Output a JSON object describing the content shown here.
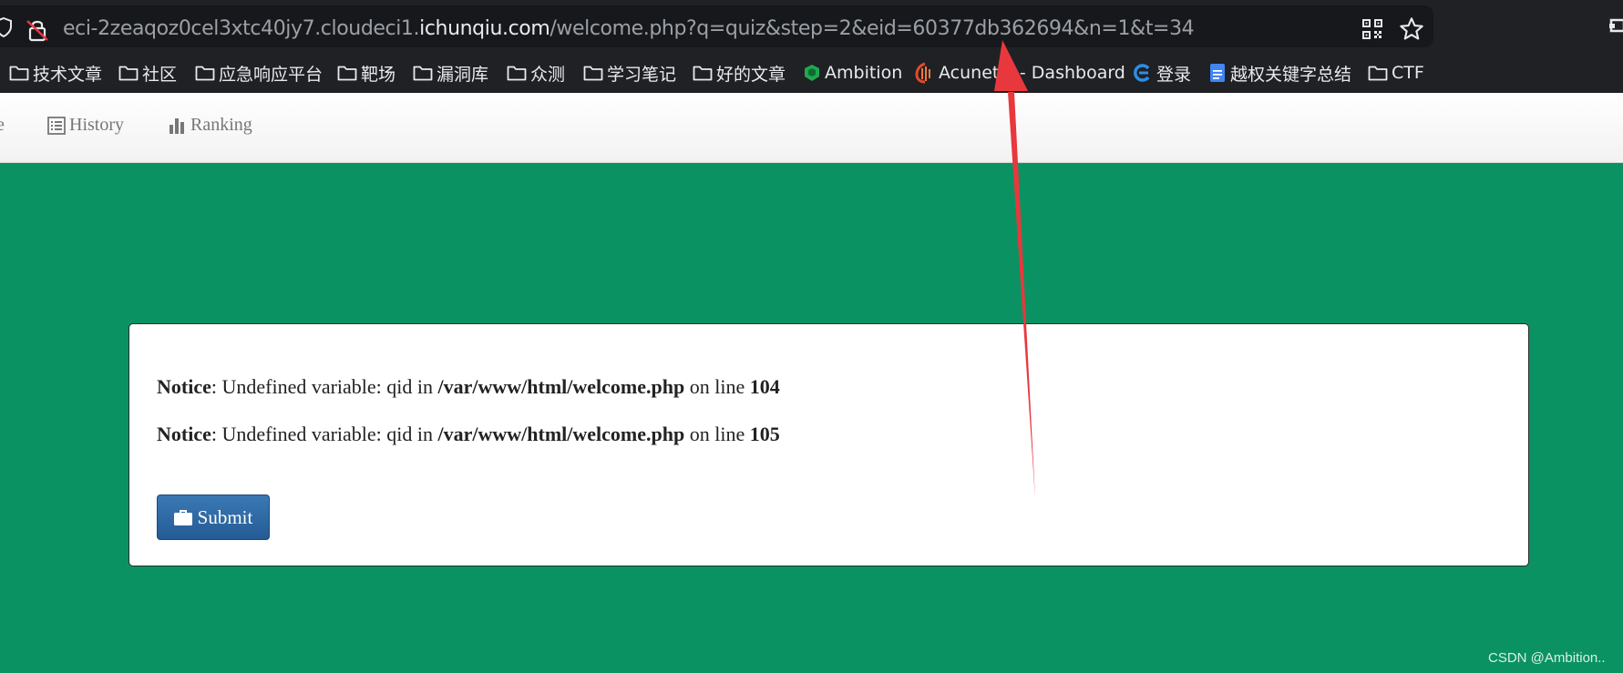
{
  "browser": {
    "url_prefix": "eci-2zeaqoz0cel3xtc40jy7.cloudeci1.",
    "url_domain": "ichunqiu.com",
    "url_path": "/welcome.php?q=quiz&step=2&eid=60377db362694&n=1&t=34"
  },
  "bookmarks": [
    {
      "label": "技术文章",
      "icon": "folder-icon"
    },
    {
      "label": "社区",
      "icon": "folder-icon"
    },
    {
      "label": "应急响应平台",
      "icon": "folder-icon"
    },
    {
      "label": "靶场",
      "icon": "folder-icon"
    },
    {
      "label": "漏洞库",
      "icon": "folder-icon"
    },
    {
      "label": "众测",
      "icon": "folder-icon"
    },
    {
      "label": "学习笔记",
      "icon": "folder-icon"
    },
    {
      "label": "好的文章",
      "icon": "folder-icon"
    },
    {
      "label": "Ambition",
      "icon": "ambition-favicon",
      "color": "#1fa84f"
    },
    {
      "label": "Acunetix - Dashboard",
      "icon": "acunetix-favicon",
      "color": "#e34b26"
    },
    {
      "label": "登录",
      "icon": "login-favicon",
      "color": "#2e8de6"
    },
    {
      "label": "越权关键字总结",
      "icon": "doc-favicon",
      "color": "#4285f4"
    },
    {
      "label": "CTF",
      "icon": "folder-icon"
    }
  ],
  "navbar": {
    "partial": "e",
    "history": "History",
    "ranking": "Ranking"
  },
  "panel": {
    "notice1": {
      "label": "Notice",
      "text1": ": Undefined variable: qid in ",
      "path": "/var/www/html/welcome.php",
      "text2": " on line ",
      "line": "104"
    },
    "notice2": {
      "label": "Notice",
      "text1": ": Undefined variable: qid in ",
      "path": "/var/www/html/welcome.php",
      "text2": " on line ",
      "line": "105"
    },
    "submit_label": "Submit"
  },
  "watermark": "CSDN @Ambition..",
  "colors": {
    "page_bg": "#0b9263",
    "annotation_arrow": "#e8383d",
    "submit_button": "#2f6ca6"
  }
}
